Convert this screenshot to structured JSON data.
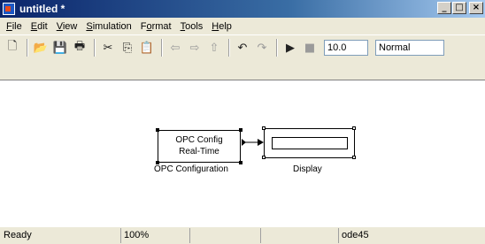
{
  "window": {
    "title": "untitled *"
  },
  "menu": [
    {
      "label": "File",
      "u": "F",
      "rest": "ile"
    },
    {
      "label": "Edit",
      "u": "E",
      "rest": "dit"
    },
    {
      "label": "View",
      "u": "V",
      "rest": "iew"
    },
    {
      "label": "Simulation",
      "u": "S",
      "rest": "imulation"
    },
    {
      "label": "Format",
      "pre": "F",
      "u": "o",
      "rest": "rmat"
    },
    {
      "label": "Tools",
      "u": "T",
      "rest": "ools"
    },
    {
      "label": "Help",
      "u": "H",
      "rest": "elp"
    }
  ],
  "toolbar": {
    "stop_time": "10.0",
    "sim_mode": "Normal"
  },
  "blocks": {
    "opc_line1": "OPC Config",
    "opc_line2": "Real-Time",
    "opc_name": "OPC Configuration",
    "display_name": "Display"
  },
  "status": {
    "ready": "Ready",
    "zoom": "100%",
    "solver": "ode45"
  }
}
